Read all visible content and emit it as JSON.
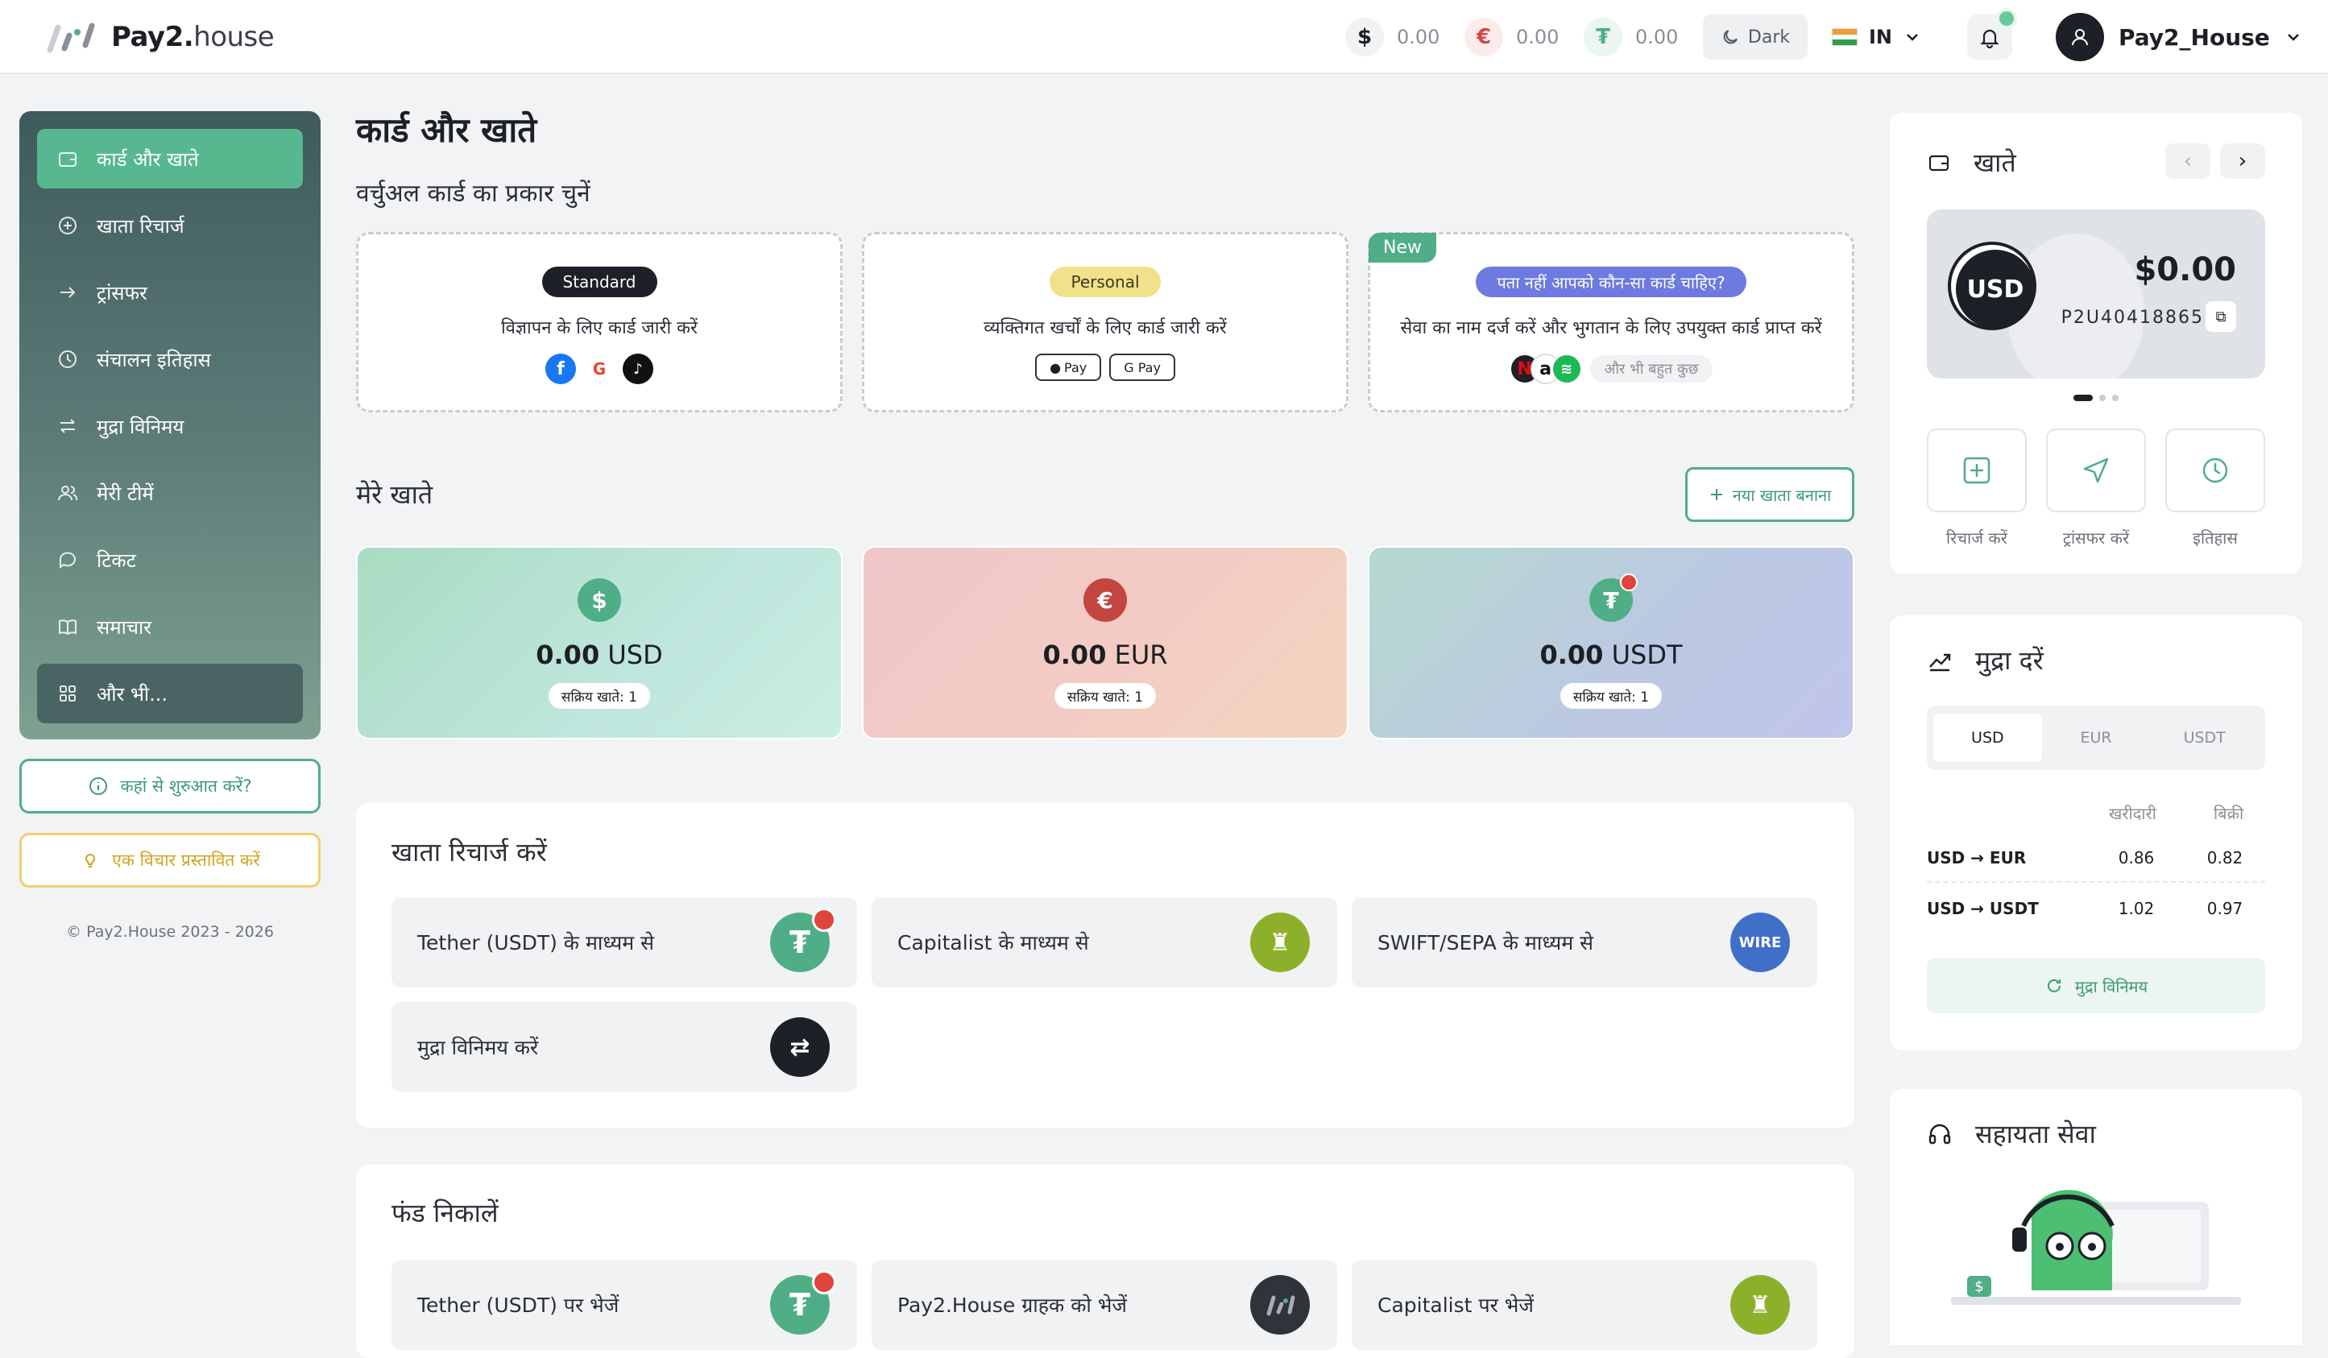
{
  "header": {
    "logo_bold": "Pay2.",
    "logo_light": "house",
    "balances": [
      {
        "symbol": "$",
        "value": "0.00",
        "color": "#1d2026",
        "bg": "#f1f2f4"
      },
      {
        "symbol": "€",
        "value": "0.00",
        "color": "#d24a43",
        "bg": "#fbeceb"
      },
      {
        "symbol": "₮",
        "value": "0.00",
        "color": "#4fae86",
        "bg": "#eaf6ef"
      }
    ],
    "theme_label": "Dark",
    "lang_code": "IN",
    "username": "Pay2_House"
  },
  "sidebar": {
    "items": [
      {
        "label": "कार्ड और खाते"
      },
      {
        "label": "खाता रिचार्ज"
      },
      {
        "label": "ट्रांसफर"
      },
      {
        "label": "संचालन इतिहास"
      },
      {
        "label": "मुद्रा विनिमय"
      },
      {
        "label": "मेरी टीमें"
      },
      {
        "label": "टिकट"
      },
      {
        "label": "समाचार"
      },
      {
        "label": "और भी..."
      }
    ],
    "start_button": "कहां से शुरुआत करें?",
    "idea_button": "एक विचार प्रस्तावित करें",
    "copyright": "© Pay2.House 2023 - 2026"
  },
  "main": {
    "title": "कार्ड और खाते",
    "card_type_title": "वर्चुअल कार्ड का प्रकार चुनें",
    "card_types": [
      {
        "pill": "Standard",
        "desc": "विज्ञापन के लिए कार्ड जारी करें"
      },
      {
        "pill": "Personal",
        "desc": "व्यक्तिगत खर्चों के लिए कार्ड जारी करें",
        "apple_pay": "Pay",
        "google_pay": "G Pay"
      },
      {
        "badge": "New",
        "pill": "पता नहीं आपको कौन-सा कार्ड चाहिए?",
        "desc": "सेवा का नाम दर्ज करें और भुगतान के लिए उपयुक्त कार्ड प्राप्त करें",
        "more": "और भी बहुत कुछ"
      }
    ],
    "accounts_title": "मेरे खाते",
    "new_account_button": "नया खाता बनाना",
    "accounts": [
      {
        "symbol": "$",
        "amount": "0.00",
        "currency": "USD",
        "active": "सक्रिय खाते: 1"
      },
      {
        "symbol": "€",
        "amount": "0.00",
        "currency": "EUR",
        "active": "सक्रिय खाते: 1"
      },
      {
        "symbol": "₮",
        "amount": "0.00",
        "currency": "USDT",
        "active": "सक्रिय खाते: 1"
      }
    ],
    "recharge_title": "खाता रिचार्ज करें",
    "recharge": [
      {
        "label": "Tether (USDT) के माध्यम से"
      },
      {
        "label": "Capitalist के माध्यम से"
      },
      {
        "label": "SWIFT/SEPA के माध्यम से",
        "icon_text": "WIRE"
      },
      {
        "label": "मुद्रा विनिमय करें"
      }
    ],
    "withdraw_title": "फंड निकालें",
    "withdraw": [
      {
        "label": "Tether (USDT) पर भेजें"
      },
      {
        "label": "Pay2.House ग्राहक को भेजें"
      },
      {
        "label": "Capitalist पर भेजें"
      }
    ]
  },
  "right": {
    "accounts_title": "खाते",
    "usd_card": {
      "currency": "USD",
      "amount": "$0.00",
      "id": "P2U40418865"
    },
    "actions": [
      {
        "label": "रिचार्ज करें"
      },
      {
        "label": "ट्रांसफर करें"
      },
      {
        "label": "इतिहास"
      }
    ],
    "rates_title": "मुद्रा दरें",
    "rate_tabs": [
      "USD",
      "EUR",
      "USDT"
    ],
    "buy_label": "खरीदारी",
    "sell_label": "बिक्री",
    "rates": [
      {
        "pair": "USD → EUR",
        "buy": "0.86",
        "sell": "0.82"
      },
      {
        "pair": "USD → USDT",
        "buy": "1.02",
        "sell": "0.97"
      }
    ],
    "exchange_button": "मुद्रा विनिमय",
    "support_title": "सहायता सेवा"
  }
}
